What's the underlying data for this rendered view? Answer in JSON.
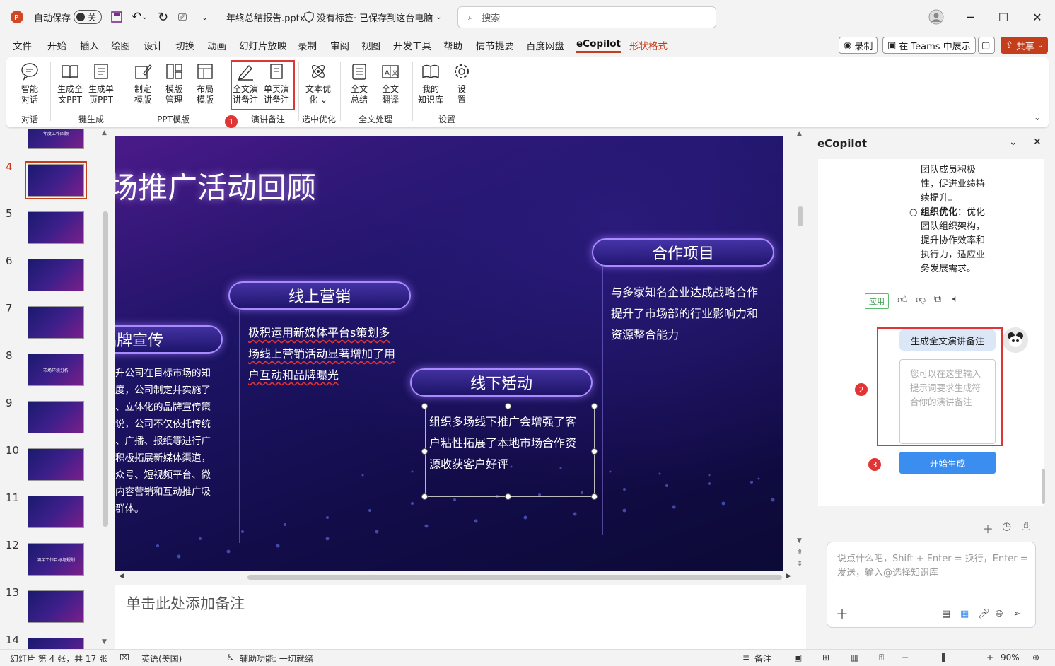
{
  "titlebar": {
    "autosave_label": "自动保存",
    "autosave_state": "关",
    "filename": "年终总结报告.pptx",
    "sensitivity": "没有标签",
    "save_status": "· 已保存到这台电脑",
    "search_placeholder": "搜索"
  },
  "menu": {
    "tabs": [
      "文件",
      "开始",
      "插入",
      "绘图",
      "设计",
      "切换",
      "动画",
      "幻灯片放映",
      "录制",
      "审阅",
      "视图",
      "开发工具",
      "帮助",
      "情节提要",
      "百度网盘",
      "eCopilot",
      "形状格式"
    ],
    "active": "eCopilot",
    "record_btn": "录制",
    "teams_btn": "在 Teams 中展示",
    "share_btn": "共享"
  },
  "ribbon": {
    "buttons": [
      {
        "label1": "智能",
        "label2": "对话"
      },
      {
        "label1": "生成全",
        "label2": "文PPT"
      },
      {
        "label1": "生成单",
        "label2": "页PPT"
      },
      {
        "label1": "制定",
        "label2": "模版"
      },
      {
        "label1": "模版",
        "label2": "管理"
      },
      {
        "label1": "布局",
        "label2": "模版"
      },
      {
        "label1": "全文演",
        "label2": "讲备注"
      },
      {
        "label1": "单页演",
        "label2": "讲备注"
      },
      {
        "label1": "文本优",
        "label2": "化 ⌄"
      },
      {
        "label1": "全文",
        "label2": "总结"
      },
      {
        "label1": "全文",
        "label2": "翻译"
      },
      {
        "label1": "我的",
        "label2": "知识库"
      },
      {
        "label1": "设",
        "label2": "置"
      }
    ],
    "groups": [
      "对话",
      "一键生成",
      "PPT模版",
      "演讲备注",
      "选中优化",
      "全文处理",
      "设置"
    ],
    "markers": [
      "1",
      "2",
      "3"
    ]
  },
  "thumbnails": {
    "numbers": [
      "4",
      "5",
      "6",
      "7",
      "8",
      "9",
      "10",
      "11",
      "12",
      "13",
      "14"
    ],
    "thumb_texts": {
      "first": "年度工作回顾",
      "t8": "市场环境分析",
      "t12": "明年工作目标与规划"
    }
  },
  "slide": {
    "title": "场推广活动回顾",
    "pill_brand": "品牌宣传",
    "pill_online": "线上营销",
    "pill_offline": "线下活动",
    "pill_coop": "合作项目",
    "brand_lines": [
      "升公司在目标市场的知",
      "度，公司制定并实施了",
      "、立体化的品牌宣传策",
      "说，公司不仅依托传统",
      "、广播、报纸等进行广",
      "积极拓展新媒体渠道，",
      "众号、短视频平台、微",
      "内容营销和互动推广吸",
      "群体。"
    ],
    "online_lines": [
      "极积运用新媒体平台s策划多",
      "场线上营销活动显著增加了用",
      "户互动和品牌曝光"
    ],
    "offline_lines": [
      "组织多场线下推广会增强了客",
      "户粘性拓展了本地市场合作资",
      "源收获客户好评"
    ],
    "coop_lines": [
      "与多家知名企业达成战略合作",
      "提升了市场部的行业影响力和",
      "资源整合能力"
    ]
  },
  "notes": {
    "placeholder": "单击此处添加备注"
  },
  "copilot": {
    "title": "eCopilot",
    "msg_lines_a": [
      "团队成员积极",
      "性，促进业绩持",
      "续提升。"
    ],
    "bullet_bold": "组织优化",
    "bullet_rest_lines": [
      "：优化",
      "团队组织架构，",
      "提升协作效率和",
      "执行力，适应业",
      "务发展需求。"
    ],
    "apply_label": "应用",
    "chip_label": "生成全文演讲备注",
    "prompt_placeholder": "您可以在这里输入提示词要求生成符合你的演讲备注",
    "generate_btn": "开始生成",
    "input_placeholder": "说点什么吧，Shift + Enter = 换行，Enter = 发送，输入@选择知识库"
  },
  "status": {
    "slide_info": "幻灯片 第 4 张，共 17 张",
    "language": "英语(美国)",
    "accessibility": "辅助功能: 一切就绪",
    "notes_btn": "备注",
    "zoom": "90%"
  }
}
